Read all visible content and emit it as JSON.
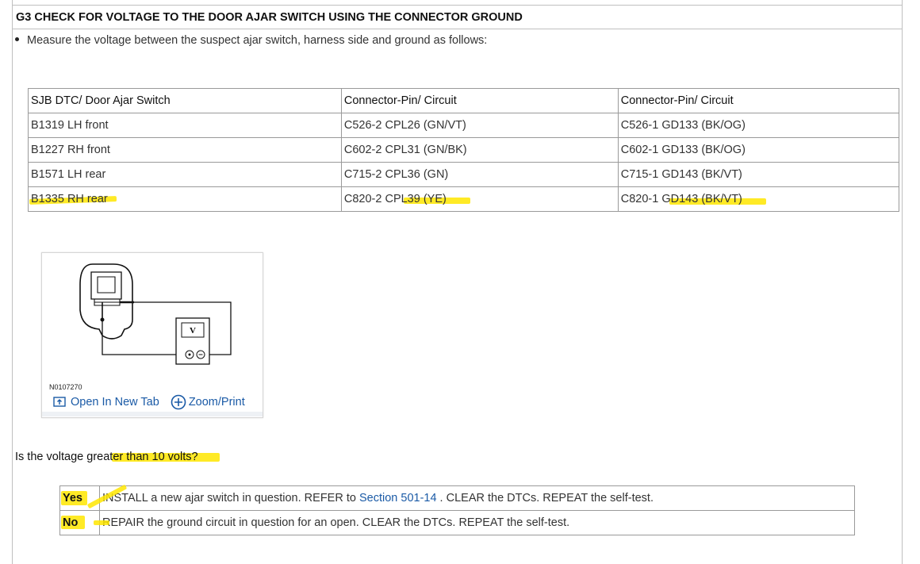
{
  "step": {
    "title": "G3  CHECK FOR VOLTAGE TO THE DOOR AJAR SWITCH USING THE CONNECTOR GROUND",
    "instruction": "Measure the voltage between the suspect ajar switch, harness side and ground as follows:"
  },
  "table": {
    "headers": [
      "SJB DTC/ Door Ajar Switch",
      "Connector-Pin/ Circuit",
      "Connector-Pin/ Circuit"
    ],
    "rows": [
      {
        "dtc": "B1319 LH front",
        "pin_a": "C526-2  CPL26 (GN/VT)",
        "pin_b": "C526-1  GD133 (BK/OG)"
      },
      {
        "dtc": "B1227 RH front",
        "pin_a": "C602-2  CPL31 (GN/BK)",
        "pin_b": "C602-1  GD133 (BK/OG)"
      },
      {
        "dtc": "B1571 LH rear",
        "pin_a": "C715-2  CPL36 (GN)",
        "pin_b": "C715-1  GD143 (BK/VT)"
      },
      {
        "dtc": "B1335 RH rear",
        "pin_a": "C820-2  CPL39 (YE)",
        "pin_b": "C820-1  GD143 (BK/VT)"
      }
    ]
  },
  "figure": {
    "id": "N0107270",
    "meter_symbol": "V",
    "open_link": "Open In New Tab",
    "zoom_link": "Zoom/Print",
    "open_icon": "open-new-tab-icon",
    "zoom_icon": "plus-circle-icon"
  },
  "question": "Is the voltage greater than 10 volts?",
  "answers": [
    {
      "key": "Yes",
      "pre": "INSTALL a new ajar switch in question. REFER to ",
      "link": "Section  501-14",
      "post": " . CLEAR the DTCs. REPEAT the self-test."
    },
    {
      "key": "No",
      "text": "REPAIR the ground circuit in question for an open. CLEAR the DTCs. REPEAT the self-test."
    }
  ],
  "colors": {
    "highlight": "#ffe600",
    "link": "#1a5aa6",
    "border": "#9a9a9a"
  }
}
